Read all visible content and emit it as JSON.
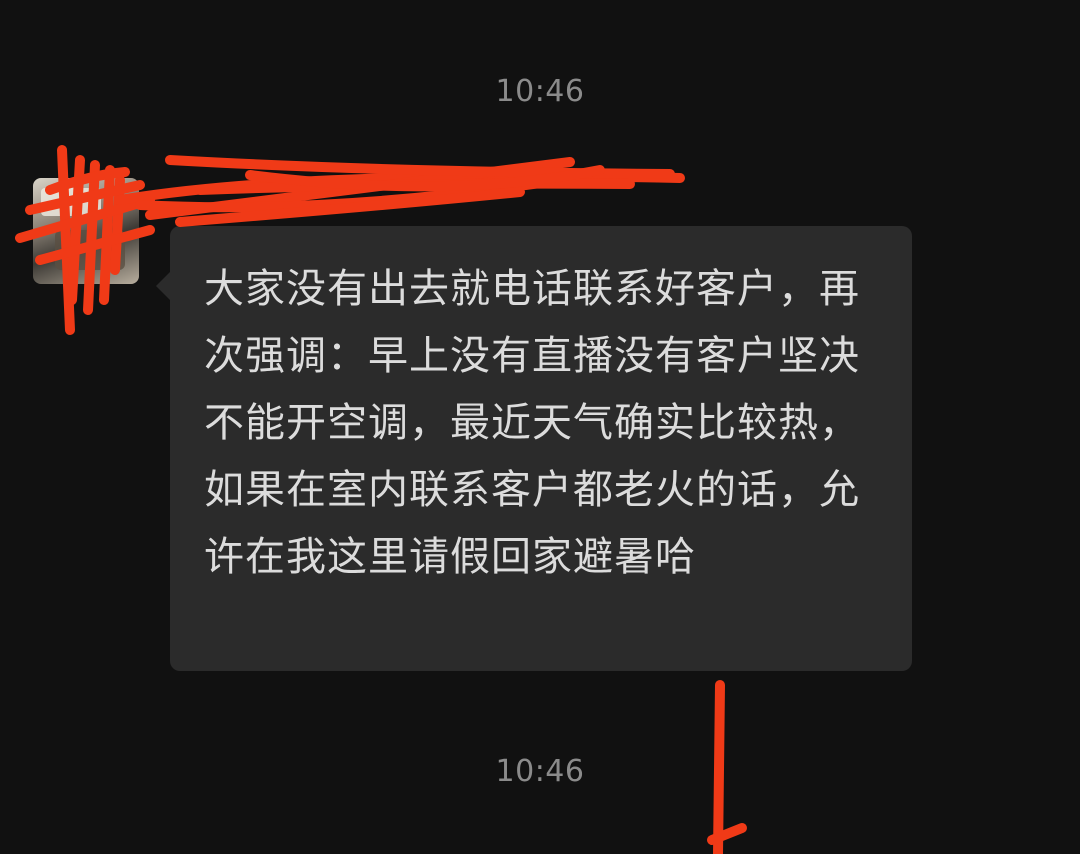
{
  "chat": {
    "timestamps": [
      "10:46",
      "10:46"
    ],
    "message": {
      "sender_name": "",
      "text": "大家没有出去就电话联系好客户，再次强调：早上没有直播没有客户坚决不能开空调，最近天气确实比较热，如果在室内联系客户都老火的话，允许在我这里请假回家避暑哈"
    }
  },
  "colors": {
    "background": "#111111",
    "bubble": "#2b2b2b",
    "text": "#dcdcdc",
    "timestamp": "#8b8b8b",
    "redaction_marker": "#f03a17"
  },
  "icons": {
    "avatar": "avatar-image"
  }
}
